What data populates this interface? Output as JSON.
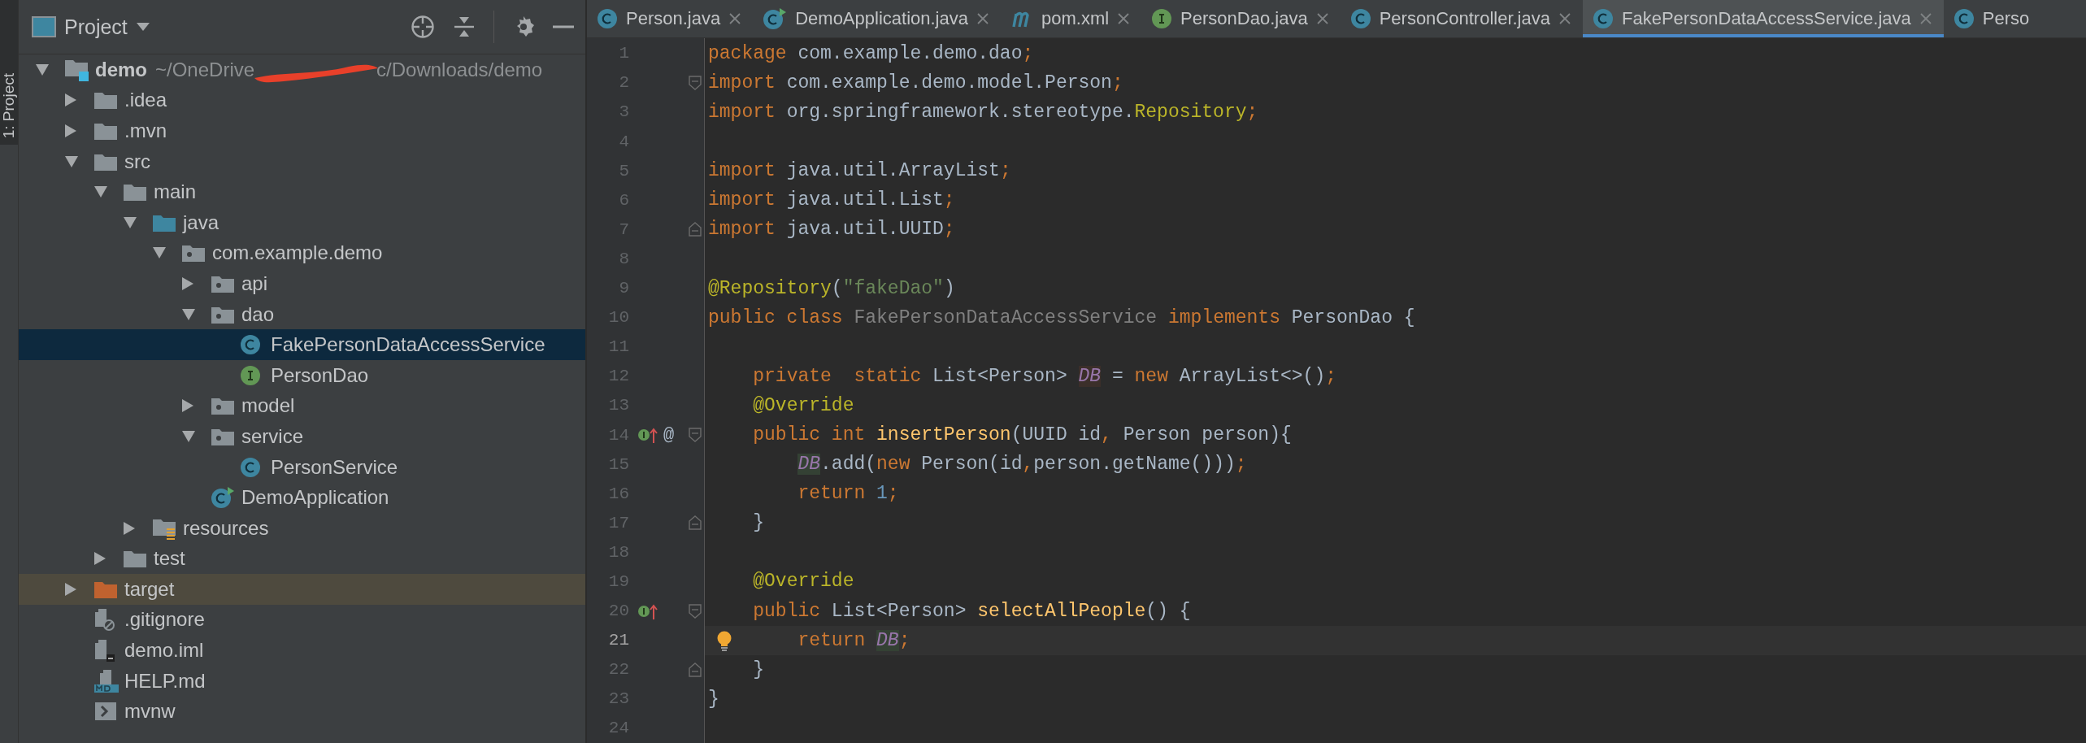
{
  "side_strip": {
    "tab_label": "1: Project",
    "selected": true
  },
  "project_panel": {
    "title": "Project",
    "tree": [
      {
        "name": "demo",
        "kind": "module",
        "expanded": true,
        "selected": false,
        "path": "~/OneDrive",
        "path_tail": "c/Downloads/demo",
        "redacted": true,
        "children": [
          {
            "name": ".idea",
            "kind": "folder",
            "expanded": false,
            "selected": false
          },
          {
            "name": ".mvn",
            "kind": "folder",
            "expanded": false,
            "selected": false
          },
          {
            "name": "src",
            "kind": "folder",
            "expanded": true,
            "selected": false,
            "children": [
              {
                "name": "main",
                "kind": "folder",
                "expanded": true,
                "selected": false,
                "children": [
                  {
                    "name": "java",
                    "kind": "source-folder",
                    "expanded": true,
                    "selected": false,
                    "children": [
                      {
                        "name": "com.example.demo",
                        "kind": "package",
                        "expanded": true,
                        "selected": false,
                        "children": [
                          {
                            "name": "api",
                            "kind": "package",
                            "expanded": false,
                            "selected": false
                          },
                          {
                            "name": "dao",
                            "kind": "package",
                            "expanded": true,
                            "selected": false,
                            "children": [
                              {
                                "name": "FakePersonDataAccessService",
                                "kind": "class",
                                "selected": true
                              },
                              {
                                "name": "PersonDao",
                                "kind": "interface",
                                "selected": false
                              }
                            ]
                          },
                          {
                            "name": "model",
                            "kind": "package",
                            "expanded": false,
                            "selected": false
                          },
                          {
                            "name": "service",
                            "kind": "package",
                            "expanded": true,
                            "selected": false,
                            "children": [
                              {
                                "name": "PersonService",
                                "kind": "class",
                                "selected": false
                              }
                            ]
                          },
                          {
                            "name": "DemoApplication",
                            "kind": "app-class",
                            "selected": false
                          }
                        ]
                      }
                    ]
                  },
                  {
                    "name": "resources",
                    "kind": "resources-folder",
                    "expanded": false,
                    "selected": false
                  }
                ]
              },
              {
                "name": "test",
                "kind": "folder",
                "expanded": false,
                "selected": false
              }
            ]
          },
          {
            "name": "target",
            "kind": "excluded-folder",
            "expanded": false,
            "selected": false,
            "highlighted": true
          },
          {
            "name": ".gitignore",
            "kind": "ignore-file",
            "selected": false
          },
          {
            "name": "demo.iml",
            "kind": "iml-file",
            "selected": false
          },
          {
            "name": "HELP.md",
            "kind": "md-file",
            "selected": false
          },
          {
            "name": "mvnw",
            "kind": "script-file",
            "selected": false
          }
        ]
      }
    ]
  },
  "tabs": [
    {
      "label": "Person.java",
      "kind": "class",
      "selected": false,
      "closable": true
    },
    {
      "label": "DemoApplication.java",
      "kind": "app-class",
      "selected": false,
      "closable": true
    },
    {
      "label": "pom.xml",
      "kind": "maven",
      "selected": false,
      "closable": true
    },
    {
      "label": "PersonDao.java",
      "kind": "interface",
      "selected": false,
      "closable": true
    },
    {
      "label": "PersonController.java",
      "kind": "class",
      "selected": false,
      "closable": true
    },
    {
      "label": "FakePersonDataAccessService.java",
      "kind": "class",
      "selected": true,
      "closable": true
    },
    {
      "label": "Perso",
      "kind": "class",
      "selected": false,
      "closable": false
    }
  ],
  "editor": {
    "lines": [
      {
        "number": "1",
        "current": false,
        "tokens": [
          {
            "kind": "keyword",
            "text": "package "
          },
          {
            "kind": "plain",
            "text": "com.example.demo.dao"
          },
          {
            "kind": "keyword",
            "text": ";"
          }
        ]
      },
      {
        "number": "2",
        "current": false,
        "fold": {
          "kind": "start"
        },
        "tokens": [
          {
            "kind": "keyword",
            "text": "import "
          },
          {
            "kind": "plain",
            "text": "com.example.demo.model.Person"
          },
          {
            "kind": "keyword",
            "text": ";"
          }
        ]
      },
      {
        "number": "3",
        "current": false,
        "tokens": [
          {
            "kind": "keyword",
            "text": "import "
          },
          {
            "kind": "plain",
            "text": "org.springframework.stereotype."
          },
          {
            "kind": "annotation",
            "text": "Repository"
          },
          {
            "kind": "keyword",
            "text": ";"
          }
        ]
      },
      {
        "number": "4",
        "current": false
      },
      {
        "number": "5",
        "current": false,
        "tokens": [
          {
            "kind": "keyword",
            "text": "import "
          },
          {
            "kind": "plain",
            "text": "java.util.ArrayList"
          },
          {
            "kind": "keyword",
            "text": ";"
          }
        ]
      },
      {
        "number": "6",
        "current": false,
        "tokens": [
          {
            "kind": "keyword",
            "text": "import "
          },
          {
            "kind": "plain",
            "text": "java.util.List"
          },
          {
            "kind": "keyword",
            "text": ";"
          }
        ]
      },
      {
        "number": "7",
        "current": false,
        "fold": {
          "kind": "end"
        },
        "tokens": [
          {
            "kind": "keyword",
            "text": "import "
          },
          {
            "kind": "plain",
            "text": "java.util.UUID"
          },
          {
            "kind": "keyword",
            "text": ";"
          }
        ]
      },
      {
        "number": "8",
        "current": false
      },
      {
        "number": "9",
        "current": false,
        "tokens": [
          {
            "kind": "annotation",
            "text": "@Repository"
          },
          {
            "kind": "plain",
            "text": "("
          },
          {
            "kind": "string",
            "text": "\"fakeDao\""
          },
          {
            "kind": "plain",
            "text": ")"
          }
        ]
      },
      {
        "number": "10",
        "current": false,
        "tokens": [
          {
            "kind": "keyword",
            "text": "public class "
          },
          {
            "kind": "unused",
            "text": "FakePersonDataAccessService"
          },
          {
            "kind": "keyword",
            "text": " implements "
          },
          {
            "kind": "plain",
            "text": "PersonDao {"
          }
        ]
      },
      {
        "number": "11",
        "current": false
      },
      {
        "number": "12",
        "current": false,
        "tokens": [
          {
            "kind": "keyword",
            "text": "    private  static "
          },
          {
            "kind": "plain",
            "text": "List<Person> "
          },
          {
            "kind": "field-declaration",
            "text": "DB"
          },
          {
            "kind": "plain",
            "text": " = "
          },
          {
            "kind": "keyword",
            "text": "new "
          },
          {
            "kind": "plain",
            "text": "ArrayList<>()"
          },
          {
            "kind": "keyword",
            "text": ";"
          }
        ]
      },
      {
        "number": "13",
        "current": false,
        "tokens": [
          {
            "kind": "annotation",
            "text": "    @Override"
          }
        ]
      },
      {
        "number": "14",
        "current": false,
        "fold": {
          "kind": "start"
        },
        "markers": [
          {
            "kind": "implements"
          },
          {
            "kind": "text",
            "text": "@"
          }
        ],
        "tokens": [
          {
            "kind": "keyword",
            "text": "    public int "
          },
          {
            "kind": "method",
            "text": "insertPerson"
          },
          {
            "kind": "plain",
            "text": "(UUID id"
          },
          {
            "kind": "keyword",
            "text": ", "
          },
          {
            "kind": "plain",
            "text": "Person person){"
          }
        ]
      },
      {
        "number": "15",
        "current": false,
        "tokens": [
          {
            "kind": "field",
            "text": "        DB"
          },
          {
            "kind": "plain",
            "text": ".add("
          },
          {
            "kind": "keyword",
            "text": "new "
          },
          {
            "kind": "plain",
            "text": "Person(id"
          },
          {
            "kind": "keyword",
            "text": ","
          },
          {
            "kind": "plain",
            "text": "person.getName()))"
          },
          {
            "kind": "keyword",
            "text": ";"
          }
        ]
      },
      {
        "number": "16",
        "current": false,
        "tokens": [
          {
            "kind": "keyword",
            "text": "        return "
          },
          {
            "kind": "number",
            "text": "1"
          },
          {
            "kind": "keyword",
            "text": ";"
          }
        ]
      },
      {
        "number": "17",
        "current": false,
        "fold": {
          "kind": "end"
        },
        "tokens": [
          {
            "kind": "plain",
            "text": "    }"
          }
        ]
      },
      {
        "number": "18",
        "current": false
      },
      {
        "number": "19",
        "current": false,
        "tokens": [
          {
            "kind": "annotation",
            "text": "    @Override"
          }
        ]
      },
      {
        "number": "20",
        "current": false,
        "fold": {
          "kind": "start"
        },
        "markers": [
          {
            "kind": "implements"
          }
        ],
        "tokens": [
          {
            "kind": "keyword",
            "text": "    public "
          },
          {
            "kind": "plain",
            "text": "List<Person> "
          },
          {
            "kind": "method",
            "text": "selectAllPeople"
          },
          {
            "kind": "plain",
            "text": "() {"
          }
        ]
      },
      {
        "number": "21",
        "current": true,
        "bulb": true,
        "tokens": [
          {
            "kind": "keyword",
            "text": "        return "
          },
          {
            "kind": "field",
            "text": "DB"
          },
          {
            "kind": "keyword",
            "text": ";"
          }
        ]
      },
      {
        "number": "22",
        "current": false,
        "fold": {
          "kind": "end"
        },
        "tokens": [
          {
            "kind": "plain",
            "text": "    }"
          }
        ]
      },
      {
        "number": "23",
        "current": false,
        "tokens": [
          {
            "kind": "plain",
            "text": "}"
          }
        ]
      },
      {
        "number": "24",
        "current": false
      }
    ]
  }
}
